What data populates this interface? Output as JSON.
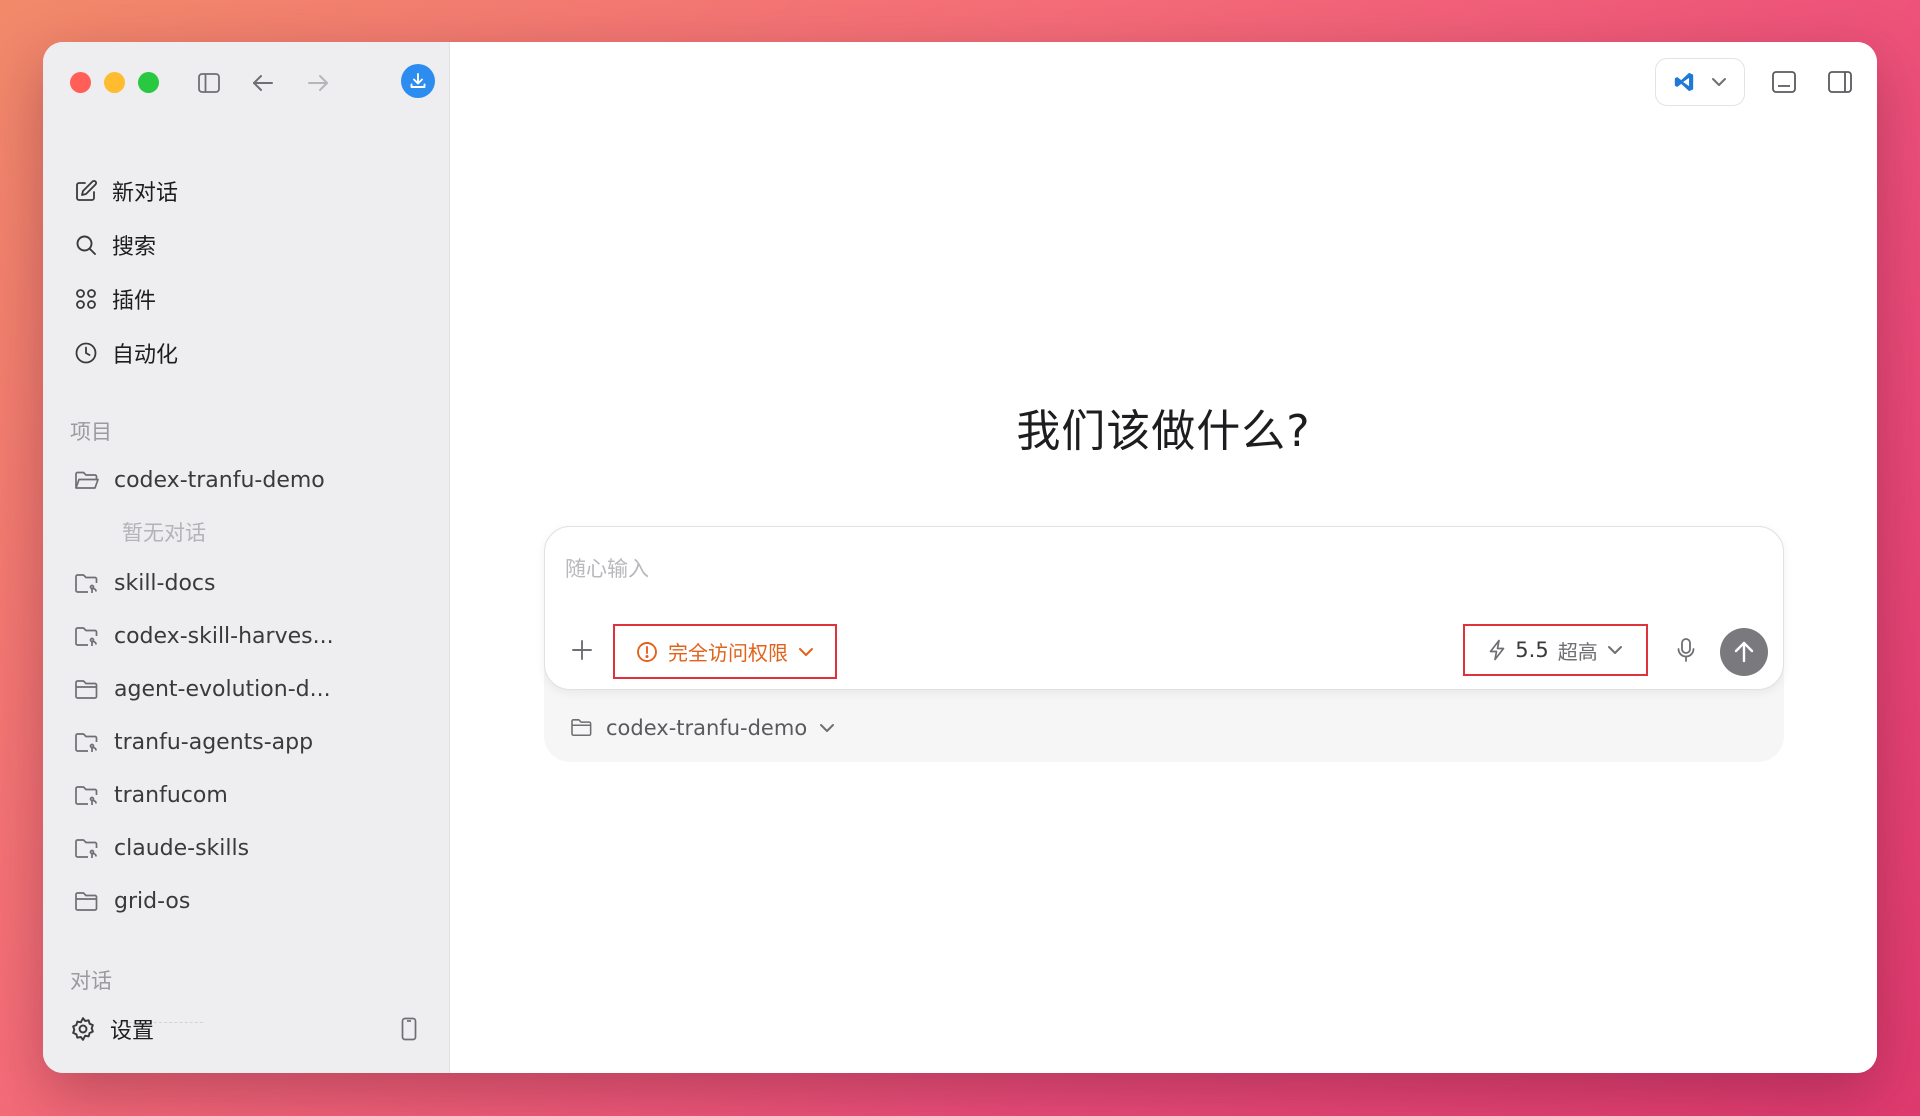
{
  "sidebar": {
    "nav": [
      {
        "label": "新对话",
        "icon": "edit-icon"
      },
      {
        "label": "搜索",
        "icon": "search-icon"
      },
      {
        "label": "插件",
        "icon": "plugins-grid-icon"
      },
      {
        "label": "自动化",
        "icon": "clock-icon"
      }
    ],
    "projects_label": "项目",
    "projects": [
      {
        "label": "codex-tranfu-demo",
        "icon": "folder-open-icon"
      },
      {
        "label": "skill-docs",
        "icon": "folder-git-icon"
      },
      {
        "label": "codex-skill-harves...",
        "icon": "folder-git-icon"
      },
      {
        "label": "agent-evolution-d...",
        "icon": "folder-icon"
      },
      {
        "label": "tranfu-agents-app",
        "icon": "folder-git-icon"
      },
      {
        "label": "tranfucom",
        "icon": "folder-git-icon"
      },
      {
        "label": "claude-skills",
        "icon": "folder-git-icon"
      },
      {
        "label": "grid-os",
        "icon": "folder-icon"
      }
    ],
    "empty_text": "暂无对话",
    "conversations_label": "对话",
    "settings_label": "设置"
  },
  "main": {
    "heading": "我们该做什么?",
    "composer": {
      "placeholder": "随心输入",
      "access_label": "完全访问权限",
      "model_version": "5.5",
      "model_effort": "超高",
      "project_label": "codex-tranfu-demo"
    }
  },
  "colors": {
    "accent_blue": "#2d8cf0",
    "warning_orange": "#e2621b",
    "highlight_red": "#e0323c",
    "send_gray": "#7a7a7e"
  }
}
